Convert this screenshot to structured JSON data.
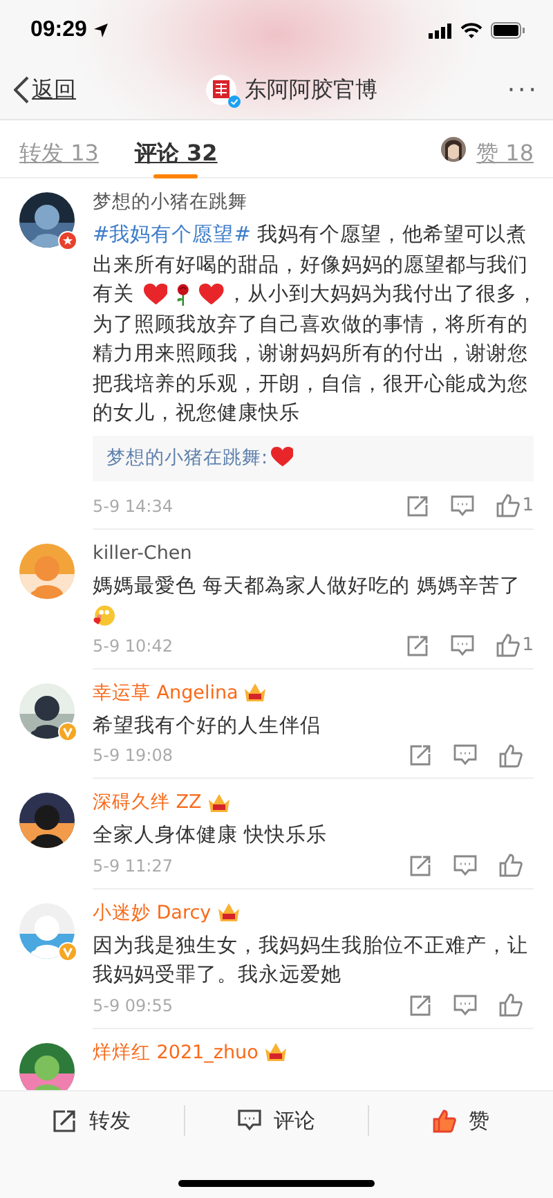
{
  "status_bar": {
    "time": "09:29"
  },
  "nav": {
    "back": "返回",
    "title": "东阿阿胶官博",
    "more": "···"
  },
  "tabs": [
    {
      "label": "转发 13",
      "selected": false
    },
    {
      "label": "评论 32",
      "selected": true
    },
    {
      "label": "赞 18",
      "selected": false,
      "kind": "likes"
    }
  ],
  "comments": [
    {
      "name": "梦想的小猪在跳舞",
      "vip": false,
      "avatar_badge": {
        "kind": "star"
      },
      "parts": [
        {
          "kind": "hashtag",
          "text": "#我妈有个愿望#"
        },
        {
          "kind": "text",
          "text": " 我妈有个愿望，他希望可以煮出来所有好喝的甜品，好像妈妈的愿望都与我们有关 "
        },
        {
          "kind": "heart"
        },
        {
          "kind": "rose"
        },
        {
          "kind": "heart"
        },
        {
          "kind": "text",
          "text": "，从小到大妈妈为我付出了很多，为了照顾我放弃了自己喜欢做的事情，将所有的精力用来照顾我，谢谢妈妈所有的付出，谢谢您把我培养的乐观，开朗，自信，很开心能成为您的女儿，祝您健康快乐"
        }
      ],
      "reply": [
        {
          "kind": "text",
          "text": "梦想的小猪在跳舞:"
        },
        {
          "kind": "heart"
        }
      ],
      "time": "5-9 14:34",
      "likes": "1"
    },
    {
      "name": "killer-Chen",
      "vip": false,
      "parts": [
        {
          "kind": "text",
          "text": "媽媽最愛色 每天都為家人做好吃的 媽媽辛苦了"
        },
        {
          "kind": "blush"
        }
      ],
      "time": "5-9 10:42",
      "likes": "1"
    },
    {
      "name": "幸运草 Angelina",
      "vip": true,
      "avatar_badge": {
        "kind": "verified"
      },
      "parts": [
        {
          "kind": "text",
          "text": "希望我有个好的人生伴侣"
        }
      ],
      "time": "5-9 19:08"
    },
    {
      "name": "深碍久绊 ZZ",
      "vip": true,
      "parts": [
        {
          "kind": "text",
          "text": "全家人身体健康 快快乐乐"
        }
      ],
      "time": "5-9 11:27"
    },
    {
      "name": "小迷妙 Darcy",
      "vip": true,
      "avatar_badge": {
        "kind": "verified"
      },
      "parts": [
        {
          "kind": "text",
          "text": "因为我是独生女，我妈妈生我胎位不正难产，让我妈妈受罪了。我永远爱她"
        }
      ],
      "time": "5-9 09:55"
    },
    {
      "name": "烊烊红 2021_zhuo",
      "vip": true
    }
  ],
  "bottom_bar": [
    {
      "kind": "repost",
      "label": "转发",
      "active": false
    },
    {
      "kind": "comment",
      "label": "评论",
      "active": false
    },
    {
      "kind": "like",
      "label": "赞",
      "active": true
    }
  ]
}
